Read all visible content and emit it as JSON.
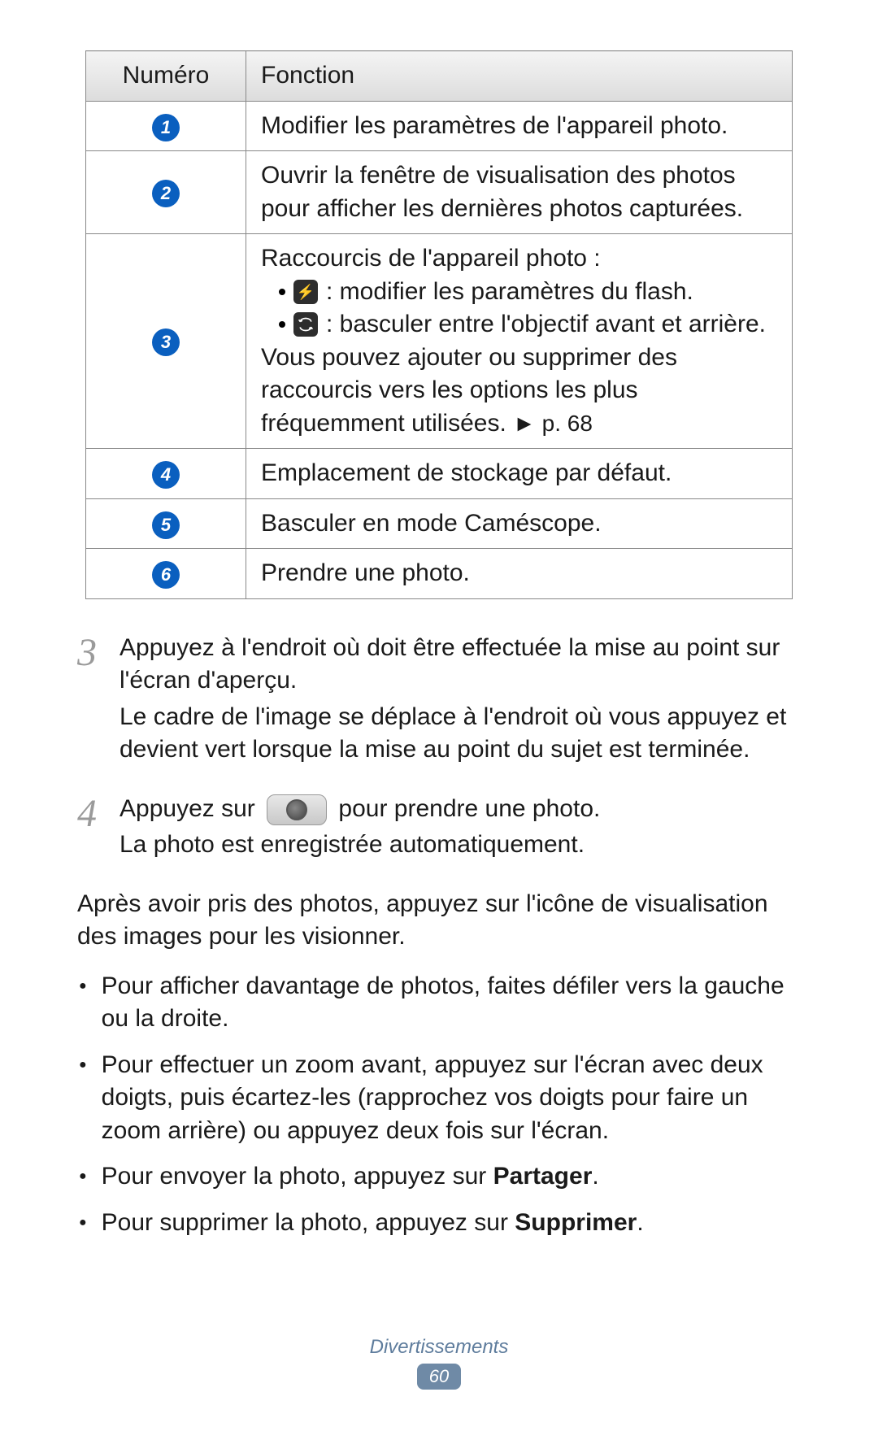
{
  "table": {
    "headers": {
      "num": "Numéro",
      "func": "Fonction"
    },
    "rows": {
      "r1": {
        "n": "1",
        "desc": "Modifier les paramètres de l'appareil photo."
      },
      "r2": {
        "n": "2",
        "desc": "Ouvrir la fenêtre de visualisation des photos pour afficher les dernières photos capturées."
      },
      "r3": {
        "n": "3",
        "intro": "Raccourcis de l'appareil photo :",
        "flash": " : modifier les paramètres du flash.",
        "switch": " : basculer entre l'objectif avant et arrière.",
        "tail": "Vous pouvez ajouter ou supprimer des raccourcis vers les options les plus fréquemment utilisées. ",
        "ref": "► p. 68"
      },
      "r4": {
        "n": "4",
        "desc": "Emplacement de stockage par défaut."
      },
      "r5": {
        "n": "5",
        "desc": "Basculer en mode Caméscope."
      },
      "r6": {
        "n": "6",
        "desc": "Prendre une photo."
      }
    }
  },
  "steps": {
    "s3": {
      "n": "3",
      "p1": "Appuyez à l'endroit où doit être effectuée la mise au point sur l'écran d'aperçu.",
      "p2": "Le cadre de l'image se déplace à l'endroit où vous appuyez et devient vert lorsque la mise au point du sujet est terminée."
    },
    "s4": {
      "n": "4",
      "p1a": "Appuyez sur ",
      "p1b": " pour prendre une photo.",
      "p2": "La photo est enregistrée automatiquement."
    }
  },
  "after": {
    "lead": "Après avoir pris des photos, appuyez sur l'icône de visualisation des images pour les visionner.",
    "tips": {
      "t1": "Pour afficher davantage de photos, faites défiler vers la gauche ou la droite.",
      "t2": "Pour effectuer un zoom avant, appuyez sur l'écran avec deux doigts, puis écartez-les (rapprochez vos doigts pour faire un zoom arrière) ou appuyez deux fois sur l'écran.",
      "t3a": "Pour envoyer la photo, appuyez sur ",
      "t3b": "Partager",
      "t3c": ".",
      "t4a": "Pour supprimer la photo, appuyez sur ",
      "t4b": "Supprimer",
      "t4c": "."
    }
  },
  "footer": {
    "section": "Divertissements",
    "page": "60"
  }
}
